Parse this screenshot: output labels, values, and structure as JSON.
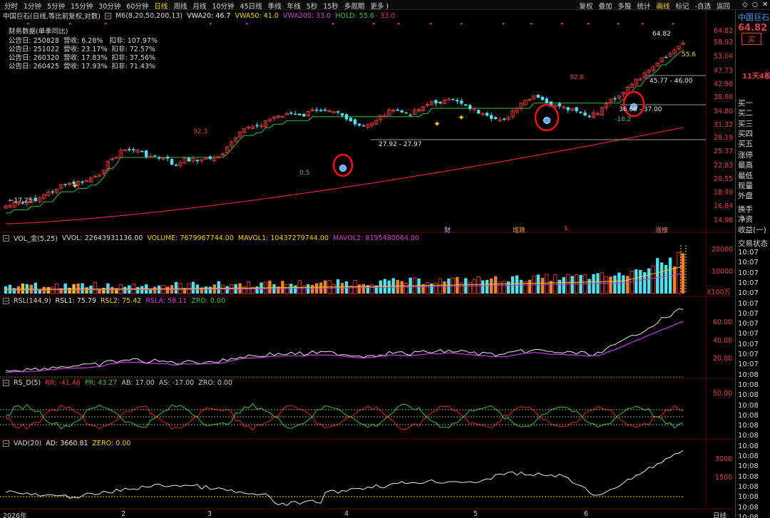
{
  "toolbar": {
    "periods": [
      "分时",
      "1分钟",
      "5分钟",
      "15分钟",
      "30分钟",
      "60分钟",
      "日线",
      "周线",
      "月线",
      "10分钟",
      "45日线",
      "季线",
      "年线",
      "5秒",
      "15秒",
      "多周期",
      "更多 )"
    ],
    "active_period": "日线",
    "tools": [
      "复权",
      "叠加",
      "多股",
      "统计",
      "画线",
      "标记",
      "-自选",
      "返回"
    ],
    "active_tool": "画线",
    "win_icons": [
      "diamond",
      "circle",
      "x"
    ]
  },
  "main": {
    "title": "中国巨石(日线,等比前复权,对数)",
    "ma_label": "M6(8,20,50,200,13)",
    "vwa20": "VWA20: 46.7",
    "vwa50": "VWA50: 41.0",
    "vwa200": "VWA200: 33.0",
    "hold": "HOLD: 55.6",
    "hold_dash": "- 33.0",
    "fin_title": "财务数据(单季同比)",
    "fin_rows": [
      "公告日: 250828  营收: 6.28%   扣非: 107.97%",
      "公告日: 251022  营收: 23.17%  扣非: 72.57%",
      "公告日: 260320  营收: 17.83%  扣非: 37.56%",
      "公告日: 260425  营收: 17.93%  扣非: 71.43%"
    ],
    "yticks": [
      "64.82",
      "58.93",
      "53.04",
      "47.73",
      "42.96",
      "38.66",
      "34.80",
      "31.32",
      "28.19",
      "25.37",
      "22.83",
      "20.55",
      "18.49",
      "16.64",
      "14.98"
    ],
    "annotations": {
      "low": "17.25",
      "peak1": "92.3",
      "pivot1": "27.92 - 27.97",
      "val_05": "0.5",
      "peak2": "92.8",
      "pivot2": "45.77 - 46.00",
      "pivot3": "36.66 - 37.00",
      "neg": "-18.2",
      "last": "64.82",
      "hold_val": "55.6"
    },
    "events": [
      "财",
      "增跌",
      "$",
      "涨榜"
    ]
  },
  "vol": {
    "title": "VOL_金(5,25)",
    "vvol": "VVOL: 22643931136.00",
    "volume": "VOLUME: 7679967744.00",
    "mavol1": "MAVOL1: 10437279744.00",
    "mavol2": "MAVOL2: 8195480064.00",
    "yticks": [
      "20000",
      "10000"
    ],
    "unit": "X100万"
  },
  "rsl": {
    "title": "RSL(144,9)",
    "rsl1": "RSL1: 75.79",
    "rsl2": "RSL2: 75.42",
    "rsla": "RSLA: 58.11",
    "zro": "ZRO: 0.00",
    "yticks": [
      "60.00",
      "40.00",
      "20.00"
    ]
  },
  "rsd": {
    "title": "RS_D(5)",
    "rr": "RR: -41.46",
    "pr": "PR: 43.27",
    "ab": "AB: 17.00",
    "as": "AS: -17.00",
    "zro": "ZRO: 0.00",
    "yticks": [
      "50.00"
    ]
  },
  "vad": {
    "title": "VAD(20)",
    "ad": "AD: 3660.81",
    "zero": "ZERO: 0.00",
    "yticks": [
      "3000",
      "1500"
    ]
  },
  "xaxis": {
    "labels": [
      "2026年",
      "2",
      "3",
      "4",
      "5",
      "6"
    ],
    "right_label": "日线"
  },
  "rightpanel": {
    "name": "中国巨石",
    "price": "64.82",
    "extra": "5",
    "buy_btn": "买",
    "streak": "11天4板",
    "book": [
      "买一",
      "买二",
      "买三",
      "买四",
      "买五"
    ],
    "stats": [
      "涨停",
      "最高",
      "最低",
      "现量",
      "外盘"
    ],
    "stats2": [
      "换手",
      "净资",
      "收益(一)"
    ],
    "trade_title": "交易状态",
    "times": [
      "10:07",
      "10:07",
      "10:07",
      "10:07",
      "10:07",
      "10:07",
      "10:07",
      "10:07",
      "10:07",
      "10:07",
      "10:07",
      "10:07",
      "10:08",
      "10:08",
      "10:08",
      "10:08",
      "10:08",
      "10:08",
      "10:08",
      "10:08",
      "10:08",
      "10:08",
      "10:08",
      "10:08",
      "10:08",
      "10:08",
      "10:08"
    ]
  },
  "colors": {
    "up": "#e8383d",
    "down": "#50e0f0",
    "ma_green": "#2fbf3a",
    "ma_red": "#e02030",
    "vol_orange": "#f08030",
    "vol_yellow": "#f0c020",
    "rsl_purple": "#c040e0"
  }
}
